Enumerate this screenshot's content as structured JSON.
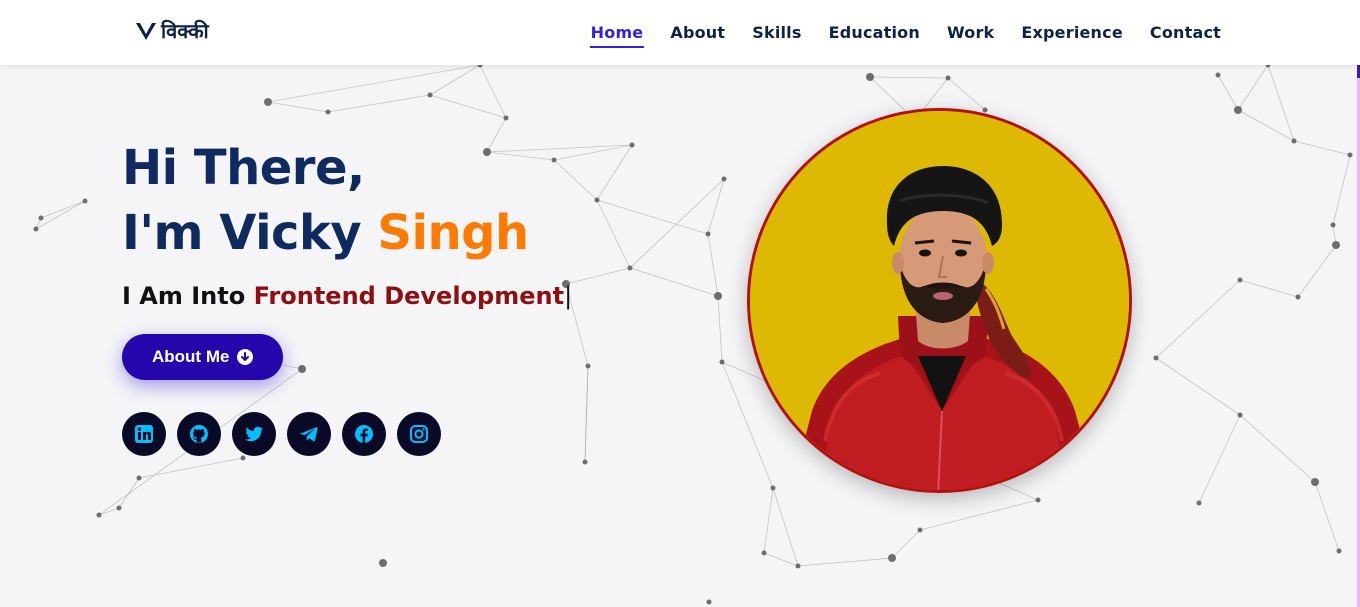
{
  "brand": {
    "logo_text": "विक्की",
    "logo_icon": "v-logo-icon"
  },
  "nav": {
    "items": [
      {
        "label": "Home",
        "active": true
      },
      {
        "label": "About",
        "active": false
      },
      {
        "label": "Skills",
        "active": false
      },
      {
        "label": "Education",
        "active": false
      },
      {
        "label": "Work",
        "active": false
      },
      {
        "label": "Experience",
        "active": false
      },
      {
        "label": "Contact",
        "active": false
      }
    ],
    "active_color": "#2f22e0"
  },
  "hero": {
    "greeting": "Hi There,",
    "name_prefix": "I'm Vicky ",
    "name_highlight": "Singh",
    "into_prefix": "I Am Into ",
    "typed_text": "Frontend Development",
    "cursor": "|",
    "button_label": "About Me",
    "button_icon": "arrow-circle-down-icon"
  },
  "socials": [
    {
      "name": "linkedin-icon"
    },
    {
      "name": "github-icon"
    },
    {
      "name": "twitter-icon"
    },
    {
      "name": "telegram-icon"
    },
    {
      "name": "facebook-icon"
    },
    {
      "name": "instagram-icon"
    }
  ],
  "colors": {
    "heading": "#0e2a5e",
    "highlight": "#ff7a00",
    "typed": "#8e0f0f",
    "button": "#2506ad",
    "social_bg": "#0b0a26",
    "social_icon": "#00bfff",
    "photo_bg": "#ddb904",
    "photo_border": "#b3100f"
  }
}
